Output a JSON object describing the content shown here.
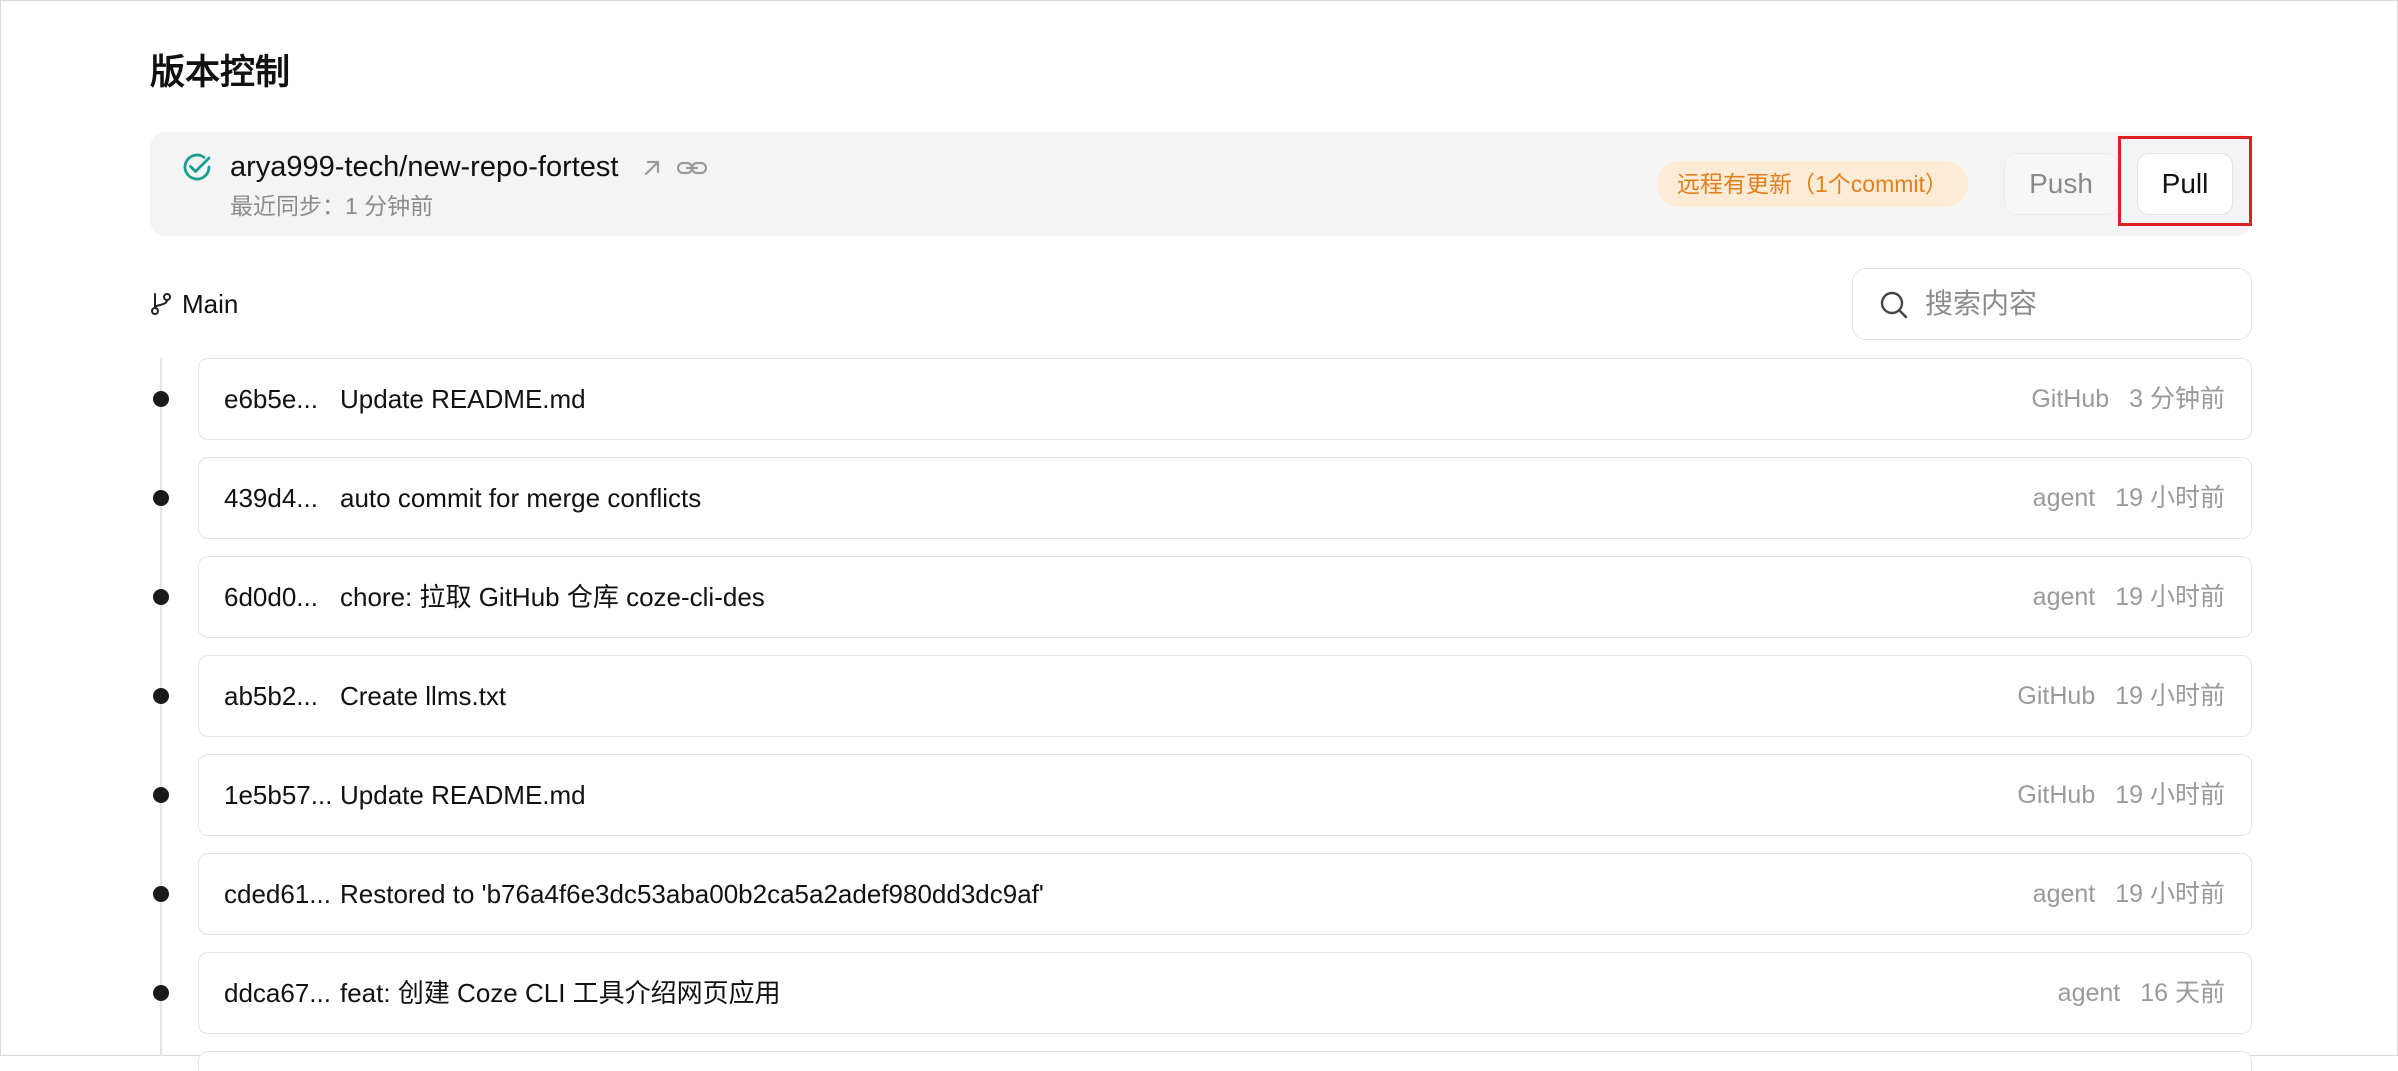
{
  "page": {
    "title": "版本控制"
  },
  "repo": {
    "name": "arya999-tech/new-repo-fortest",
    "sync_status": "最近同步：1 分钟前",
    "update_badge": "远程有更新（1个commit）",
    "status_icon": "check-circle-icon",
    "accent_color": "#1a9e8f"
  },
  "actions": {
    "push_label": "Push",
    "pull_label": "Pull"
  },
  "branch": {
    "name": "Main",
    "icon": "git-branch-icon"
  },
  "search": {
    "placeholder": "搜索内容",
    "value": ""
  },
  "commits": [
    {
      "hash": "e6b5e...",
      "message": "Update README.md",
      "author": "GitHub",
      "time": "3 分钟前"
    },
    {
      "hash": "439d4...",
      "message": "auto commit for merge conflicts",
      "author": "agent",
      "time": "19 小时前"
    },
    {
      "hash": "6d0d0...",
      "message": "chore: 拉取 GitHub 仓库 coze-cli-des",
      "author": "agent",
      "time": "19 小时前"
    },
    {
      "hash": "ab5b2...",
      "message": "Create llms.txt",
      "author": "GitHub",
      "time": "19 小时前"
    },
    {
      "hash": "1e5b57...",
      "message": "Update README.md",
      "author": "GitHub",
      "time": "19 小时前"
    },
    {
      "hash": "cded61...",
      "message": "Restored to 'b76a4f6e3dc53aba00b2ca5a2adef980dd3dc9af'",
      "author": "agent",
      "time": "19 小时前"
    },
    {
      "hash": "ddca67...",
      "message": "feat: 创建 Coze CLI 工具介绍网页应用",
      "author": "agent",
      "time": "16 天前"
    }
  ]
}
